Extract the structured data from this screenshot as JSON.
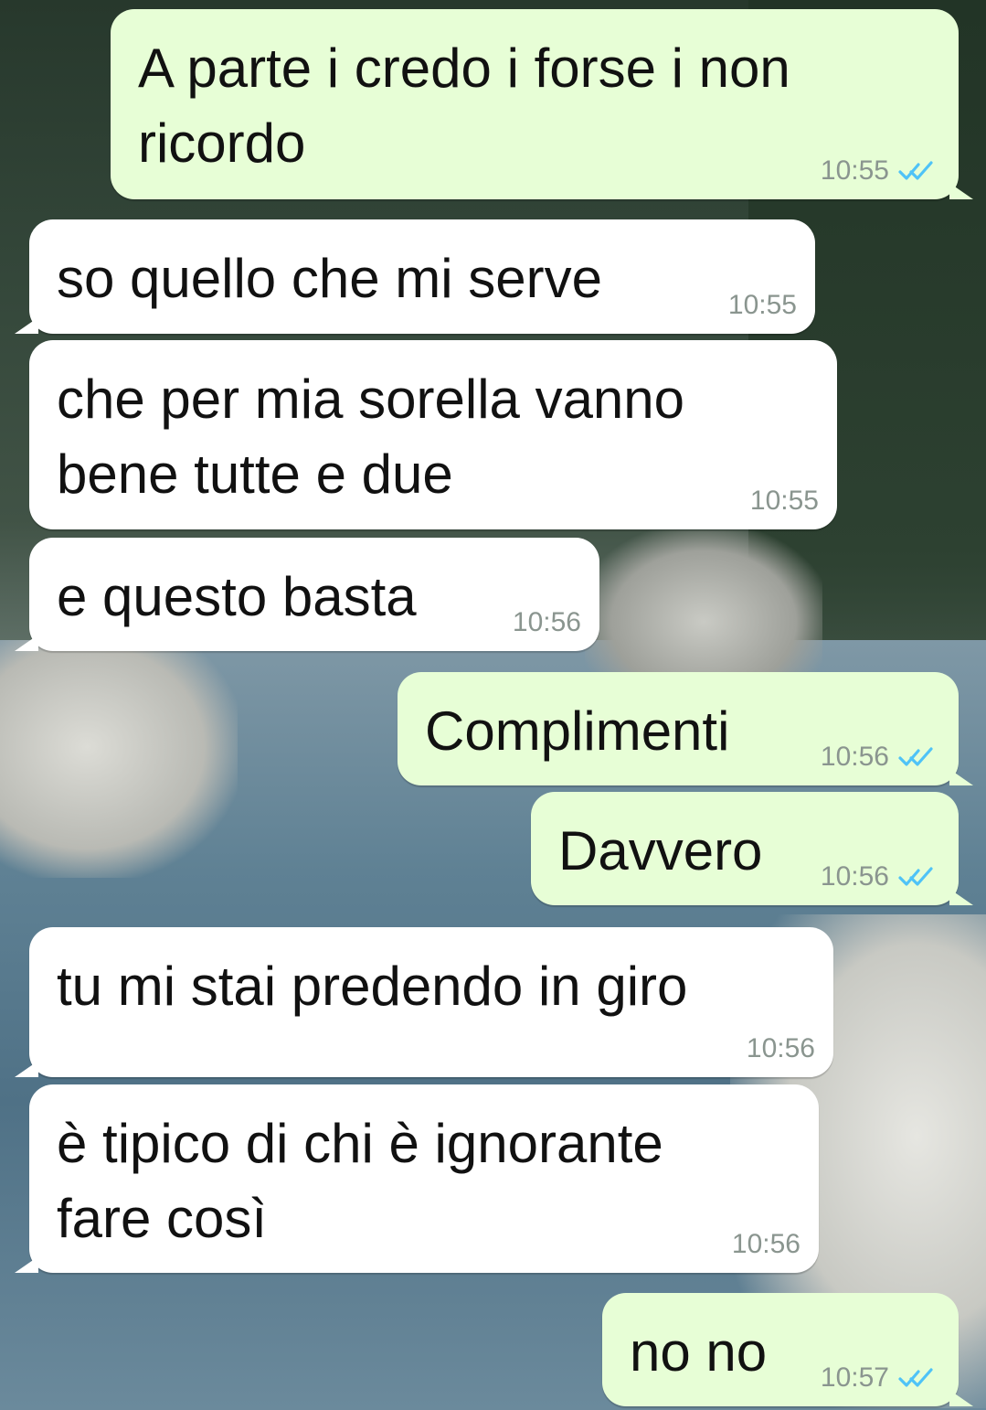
{
  "messages": [
    {
      "direction": "out",
      "text": "A parte i credo i forse i non\nricordo",
      "time": "10:55",
      "read": true
    },
    {
      "direction": "in",
      "text": "so quello che mi serve",
      "time": "10:55"
    },
    {
      "direction": "in",
      "text": "che per mia sorella vanno\nbene tutte e due",
      "time": "10:55"
    },
    {
      "direction": "in",
      "text": "e questo basta",
      "time": "10:56"
    },
    {
      "direction": "out",
      "text": "Complimenti",
      "time": "10:56",
      "read": true
    },
    {
      "direction": "out",
      "text": "Davvero",
      "time": "10:56",
      "read": true
    },
    {
      "direction": "in",
      "text": "tu mi stai predendo in giro",
      "time": "10:56"
    },
    {
      "direction": "in",
      "text": "è tipico di chi è ignorante\nfare così",
      "time": "10:56"
    },
    {
      "direction": "out",
      "text": "no no",
      "time": "10:57",
      "read": true
    }
  ],
  "colors": {
    "outgoing_bubble": "#e7fed6",
    "incoming_bubble": "#ffffff",
    "read_ticks": "#4fc3f7",
    "timestamp": "#8a958f"
  },
  "icons": {
    "read_receipt": "double-check-icon",
    "wallpaper": "river-landscape-wallpaper"
  }
}
